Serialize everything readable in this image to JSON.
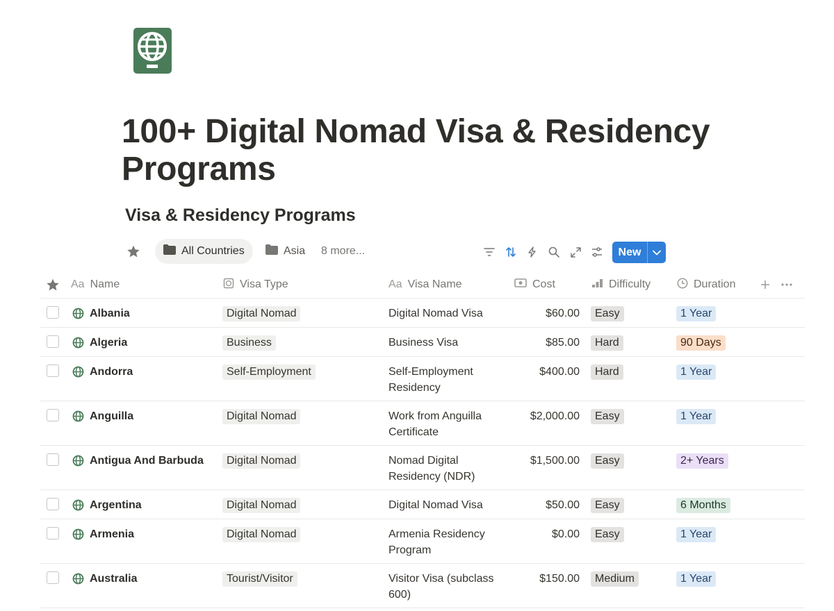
{
  "page": {
    "icon": "passport-icon",
    "title": "100+ Digital Nomad Visa & Residency Programs"
  },
  "database": {
    "title": "Visa & Residency Programs"
  },
  "views": {
    "favorite_icon": "star-icon",
    "tabs": [
      {
        "label": "All Countries",
        "icon": "folder-icon",
        "active": true
      },
      {
        "label": "Asia",
        "icon": "folder-icon",
        "active": false
      }
    ],
    "more_label": "8 more...",
    "tools": [
      "filter-icon",
      "sort-icon",
      "automation-icon",
      "search-icon",
      "expand-icon",
      "settings-icon"
    ],
    "new_label": "New"
  },
  "columns": {
    "name": "Name",
    "visa_type": "Visa Type",
    "visa_name": "Visa Name",
    "cost": "Cost",
    "difficulty": "Difficulty",
    "duration": "Duration"
  },
  "colors": {
    "accent": "#2f7ed8",
    "icon_green": "#4a7c59",
    "tag_blue": "#dbe9f6",
    "tag_orange": "#fadec9",
    "tag_purple": "#eadff6",
    "tag_green": "#dcebe1"
  },
  "rows": [
    {
      "name": "Albania",
      "visa_type": "Digital Nomad",
      "visa_name": "Digital Nomad Visa",
      "cost": "$60.00",
      "difficulty": "Easy",
      "duration": "1 Year",
      "duration_color": "blue"
    },
    {
      "name": "Algeria",
      "visa_type": "Business",
      "visa_name": "Business Visa",
      "cost": "$85.00",
      "difficulty": "Hard",
      "duration": "90 Days",
      "duration_color": "orange"
    },
    {
      "name": "Andorra",
      "visa_type": "Self-Employment",
      "visa_name": "Self-Employment Residency",
      "cost": "$400.00",
      "difficulty": "Hard",
      "duration": "1 Year",
      "duration_color": "blue"
    },
    {
      "name": "Anguilla",
      "visa_type": "Digital Nomad",
      "visa_name": "Work from Anguilla Certificate",
      "cost": "$2,000.00",
      "difficulty": "Easy",
      "duration": "1 Year",
      "duration_color": "blue"
    },
    {
      "name": "Antigua And Barbuda",
      "visa_type": "Digital Nomad",
      "visa_name": "Nomad Digital Residency (NDR)",
      "cost": "$1,500.00",
      "difficulty": "Easy",
      "duration": "2+ Years",
      "duration_color": "purple"
    },
    {
      "name": "Argentina",
      "visa_type": "Digital Nomad",
      "visa_name": "Digital Nomad Visa",
      "cost": "$50.00",
      "difficulty": "Easy",
      "duration": "6 Months",
      "duration_color": "green"
    },
    {
      "name": "Armenia",
      "visa_type": "Digital Nomad",
      "visa_name": "Armenia Residency Program",
      "cost": "$0.00",
      "difficulty": "Easy",
      "duration": "1 Year",
      "duration_color": "blue"
    },
    {
      "name": "Australia",
      "visa_type": "Tourist/Visitor",
      "visa_name": "Visitor Visa (subclass 600)",
      "cost": "$150.00",
      "difficulty": "Medium",
      "duration": "1 Year",
      "duration_color": "blue"
    }
  ]
}
